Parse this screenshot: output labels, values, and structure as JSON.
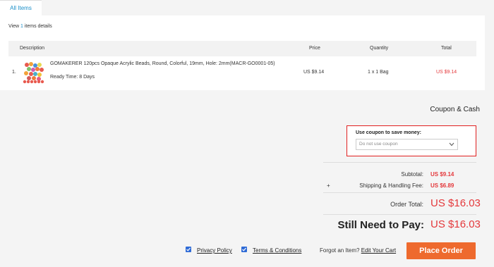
{
  "tabs": {
    "all_items": "All Items"
  },
  "items_summary": {
    "prefix": "View ",
    "count": "1",
    "suffix": " items details"
  },
  "table": {
    "headers": {
      "description": "Description",
      "price": "Price",
      "quantity": "Quantity",
      "total": "Total"
    },
    "rows": [
      {
        "index": "1.",
        "name": "GOMAKERER 120pcs Opaque Acrylic Beads, Round, Colorful, 19mm, Hole: 2mm(MACR-GO0001-05)",
        "ready_time": "Ready Time: 8 Days",
        "price": "US $9.14",
        "quantity": "1 x 1 Bag",
        "total": "US $9.14"
      }
    ]
  },
  "coupon": {
    "section_title": "Coupon & Cash",
    "label": "Use coupon to save money:",
    "selected": "Do not use coupon"
  },
  "summary": {
    "subtotal_label": "Subtotal:",
    "subtotal_value": "US $9.14",
    "shipping_prefix": "+",
    "shipping_label": "Shipping & Handling Fee:",
    "shipping_value": "US $6.89",
    "order_total_label": "Order Total:",
    "order_total_value": "US $16.03",
    "need_to_pay_label": "Still Need to Pay:",
    "need_to_pay_value": "US $16.03"
  },
  "footer": {
    "privacy_checked": true,
    "privacy_label": "Privacy Policy",
    "terms_checked": true,
    "terms_label": "Terms & Conditions",
    "forgot_text": "Forgot an Item?",
    "edit_cart_label": "Edit Your Cart",
    "place_order_label": "Place Order"
  },
  "colors": {
    "accent": "#1a8fc9",
    "price_red": "#e4393c",
    "button_orange": "#ee6a2e",
    "highlight_border": "#e02020",
    "checkbox_blue": "#2f6bd6"
  }
}
